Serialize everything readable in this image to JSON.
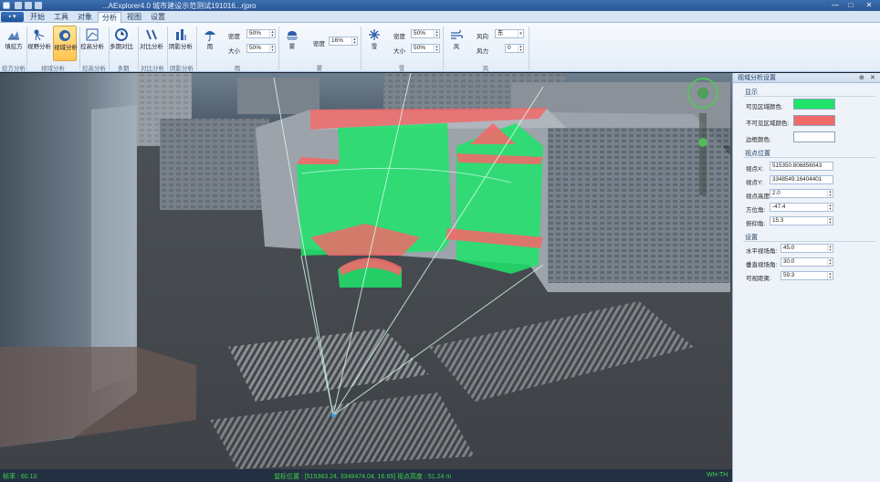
{
  "window": {
    "title": "...AExplorer4.0 城市建设示范测试191016...rjpro",
    "minimize": "—",
    "maximize": "□",
    "close": "✕"
  },
  "menu": {
    "file_label": "▪ ▾",
    "tabs": [
      "开始",
      "工具",
      "对象",
      "分析",
      "视图",
      "设置"
    ],
    "active_tab": "分析"
  },
  "ribbon": {
    "buttons": [
      {
        "label": "填挖方",
        "icon": "fill-cut-icon"
      },
      {
        "label": "视野分析",
        "icon": "viewshed-icon"
      },
      {
        "label": "视域分析",
        "icon": "visibility-icon",
        "active": true
      },
      {
        "label": "控高分析",
        "icon": "height-control-icon"
      },
      {
        "label": "多期对比",
        "icon": "multi-period-icon"
      },
      {
        "label": "对比分析",
        "icon": "compare-icon"
      },
      {
        "label": "阴影分析",
        "icon": "shadow-icon"
      },
      {
        "label": "雨",
        "icon": "rain-icon"
      },
      {
        "label": "雾",
        "icon": "fog-icon"
      },
      {
        "label": "雪",
        "icon": "snow-icon"
      },
      {
        "label": "风",
        "icon": "wind-icon"
      }
    ],
    "groups": [
      "挖方分析",
      "视域分析",
      "控高分析",
      "多期",
      "对比分析",
      "阴影分析",
      "雨",
      "雾",
      "雪",
      "风"
    ],
    "rain": {
      "density_label": "密度",
      "density_value": "50%",
      "size_label": "大小",
      "size_value": "50%"
    },
    "fog": {
      "density_label": "密度",
      "density_value": "16%"
    },
    "snow": {
      "density_label": "密度",
      "density_value": "50%",
      "size_label": "大小",
      "size_value": "50%"
    },
    "wind": {
      "direction_label": "风向",
      "direction_value": "东",
      "force_label": "风力",
      "force_value": "0"
    }
  },
  "status": {
    "fps": "帧率 : 60.10",
    "position": "鼠标位置 : [515363.24, 3348474.04, 16.65]   视点高度 : 51.24 m",
    "right": "WH-TH"
  },
  "panel": {
    "title": "视域分析设置",
    "pin": "⊕",
    "close": "✕",
    "display_section": "显示",
    "visible_color_label": "可见区域颜色:",
    "invisible_color_label": "不可见区域颜色:",
    "border_color_label": "边框颜色:",
    "viewpoint_section": "视点位置",
    "x_label": "视点X:",
    "x_value": "515350.806856043",
    "y_label": "视点Y:",
    "y_value": "3348549.16404401",
    "height_label": "视点高度:",
    "height_value": "2.0",
    "azimuth_label": "方位角:",
    "azimuth_value": "-47.4",
    "pitch_label": "俯仰角:",
    "pitch_value": "15.3",
    "settings_section": "设置",
    "hfov_label": "水平视场角:",
    "hfov_value": "45.0",
    "vfov_label": "垂直视场角:",
    "vfov_value": "30.0",
    "distance_label": "可视距离:",
    "distance_value": "59.3"
  },
  "colors": {
    "visible": "#1fe46a",
    "invisible": "#f06a6a",
    "border": "#ffffff",
    "status_text": "#44d04a",
    "ribbon_active": "#ffc550"
  }
}
